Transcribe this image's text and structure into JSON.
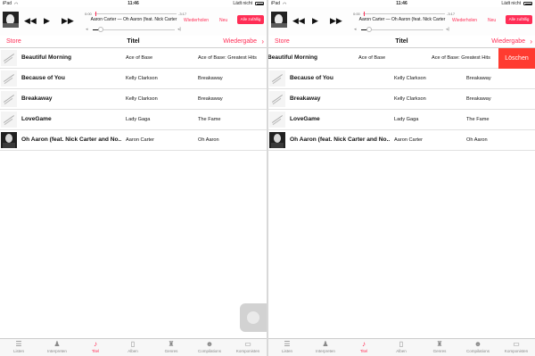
{
  "status": {
    "carrier": "iPad",
    "time": "11:46",
    "charging": "Lädt nicht",
    "wifi": "wifi-icon"
  },
  "player": {
    "elapsed": "0:00",
    "remaining": "-3:17",
    "now_playing": "Aaron Carter — Oh Aaron (feat. Nick Carter",
    "repeat_label": "Wiederholen",
    "new_label": "Neu",
    "shuffle_label": "Alle zufällig",
    "progress": 0.01,
    "volume": 0.1
  },
  "nav": {
    "store": "Store",
    "title": "Titel",
    "now_playing": "Wiedergabe"
  },
  "songs": [
    {
      "title": "Beautiful Morning",
      "artist": "Ace of Base",
      "album": "Ace of Base: Greatest Hits"
    },
    {
      "title": "Because of You",
      "artist": "Kelly Clarkson",
      "album": "Breakaway"
    },
    {
      "title": "Breakaway",
      "artist": "Kelly Clarkson",
      "album": "Breakaway"
    },
    {
      "title": "LoveGame",
      "artist": "Lady Gaga",
      "album": "The Fame"
    },
    {
      "title": "Oh Aaron (feat. Nick Carter and No...",
      "artist": "Aaron Carter",
      "album": "Oh Aaron"
    }
  ],
  "delete_label": "Löschen",
  "tabs": [
    {
      "label": "Listen",
      "icon": "playlist-icon"
    },
    {
      "label": "Interpreten",
      "icon": "artist-icon"
    },
    {
      "label": "Titel",
      "icon": "music-note-icon"
    },
    {
      "label": "Alben",
      "icon": "album-icon"
    },
    {
      "label": "Genres",
      "icon": "genre-icon"
    },
    {
      "label": "Compilations",
      "icon": "compilation-icon"
    },
    {
      "label": "Komponisten",
      "icon": "composer-icon"
    }
  ],
  "accent_color": "#ff2d55",
  "delete_color": "#ff3b30"
}
